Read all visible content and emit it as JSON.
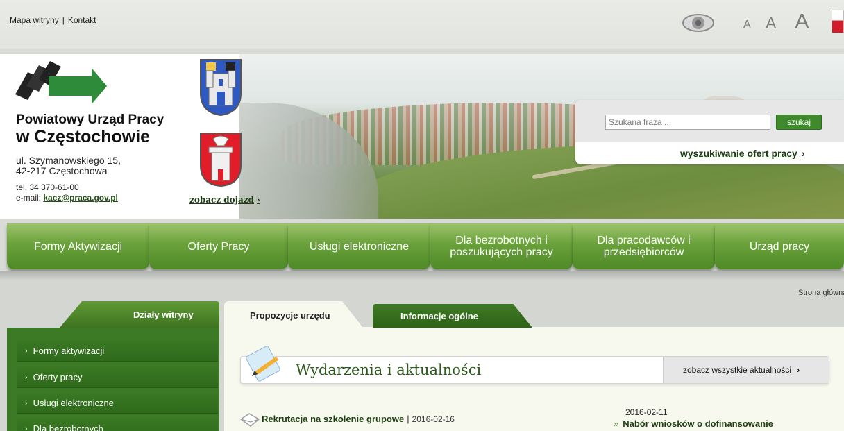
{
  "top": {
    "sitemap": "Mapa witryny",
    "separator": "|",
    "contact": "Kontakt",
    "font_small": "A",
    "font_medium": "A",
    "font_large": "A",
    "contrast_icon": "eye-icon"
  },
  "header": {
    "org_name": "Powiatowy Urząd Pracy",
    "org_city": "w Częstochowie",
    "address_line1": "ul. Szymanowskiego 15,",
    "address_line2": "42-217 Częstochowa",
    "tel": "tel. 34 370-61-00",
    "email_label": "e-mail:",
    "email": "kacz@praca.gov.pl",
    "directions_link": "zobacz dojazd",
    "search_placeholder": "Szukana fraza ...",
    "search_button": "szukaj",
    "job_search_link": "wyszukiwanie ofert pracy"
  },
  "nav": {
    "items": [
      {
        "label": "Formy Aktywizacji"
      },
      {
        "label": "Oferty Pracy"
      },
      {
        "label": "Usługi elektroniczne"
      },
      {
        "label": "Dla bezrobotnych i poszukujących pracy"
      },
      {
        "label": "Dla pracodawców i przedsiębiorców"
      },
      {
        "label": "Urząd pracy"
      }
    ]
  },
  "breadcrumb": "Strona główna",
  "sidebar": {
    "title": "Działy witryny",
    "items": [
      {
        "label": "Formy aktywizacji"
      },
      {
        "label": "Oferty pracy"
      },
      {
        "label": "Usługi elektroniczne"
      },
      {
        "label": "Dla bezrobotnych"
      }
    ]
  },
  "tabs": {
    "active": "Propozycje urzędu",
    "inactive": "Informacje ogólne"
  },
  "news": {
    "section_title": "Wydarzenia i aktualności",
    "all_news_link": "zobacz wszystkie aktualności",
    "item1_title": "Rekrutacja na szkolenie grupowe",
    "item1_sep": "|",
    "item1_date": "2016-02-16",
    "item2_date": "2016-02-11",
    "item2_title": "Nabór wniosków o dofinansowanie"
  },
  "colors": {
    "accent_green": "#3e8a2c",
    "nav_green": "#6aa13b",
    "dark_green": "#2e6318"
  }
}
